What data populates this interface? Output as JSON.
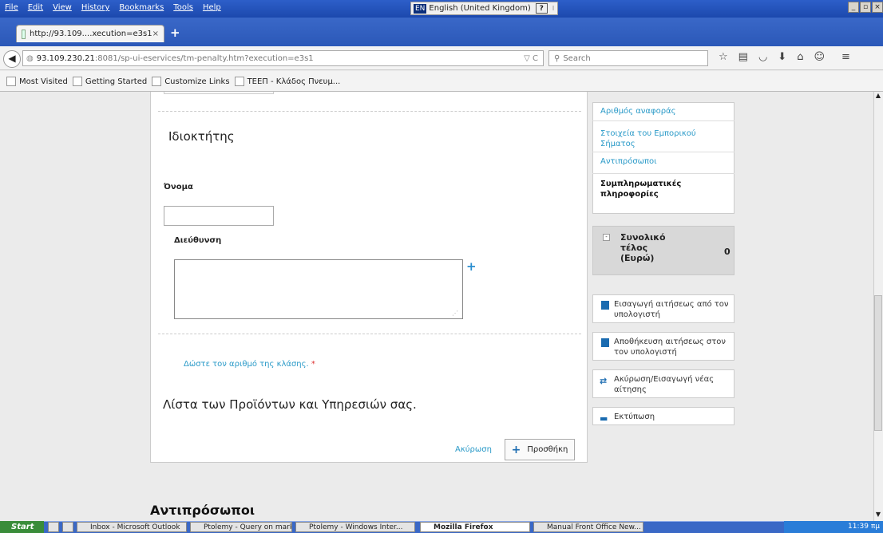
{
  "menubar": {
    "items": [
      "File",
      "Edit",
      "View",
      "History",
      "Bookmarks",
      "Tools",
      "Help"
    ]
  },
  "language": {
    "code": "EN",
    "label": "English (United Kingdom)",
    "help": "?"
  },
  "tab": {
    "title": "http://93.109....xecution=e3s1",
    "close": "×",
    "new": "+"
  },
  "urlbar": {
    "host": "93.109.230.21",
    "rest": ":8081/sp-ui-eservices/tm-penalty.htm?execution=e3s1",
    "reload": "▽ C"
  },
  "search": {
    "placeholder": "Search"
  },
  "bookmarks": [
    "Most Visited",
    "Getting Started",
    "Customize Links",
    "ΤΕΕΠ - Κλάδος Πνευμ..."
  ],
  "form": {
    "owner_heading": "Ιδιοκτήτης",
    "name_label": "Όνομα",
    "name_value": "",
    "address_label": "Διεύθυνση",
    "address_value": "",
    "add_address": "+",
    "class_link": "Δώστε τον αριθμό της κλάσης.",
    "required_mark": "*",
    "products_heading": "Λίστα των Προϊόντων και Υπηρεσιών σας.",
    "cancel": "Ακύρωση",
    "add_button": "Προσθήκη",
    "representatives_heading": "Αντιπρόσωποι"
  },
  "sidenav": {
    "items": [
      "Αριθμός αναφοράς",
      "Στοιχεία του Εμπορικού Σήματος",
      "Αντιπρόσωποι"
    ],
    "active": "Συμπληρωματικές πληροφορίες"
  },
  "total": {
    "label": "Συνολικό τέλος (Ευρώ)",
    "value": "0"
  },
  "actions": {
    "import": "Εισαγωγή αιτήσεως από τον υπολογιστή",
    "save": "Αποθήκευση αιτήσεως στον τον υπολογιστή",
    "cancel_new": "Ακύρωση/Εισαγωγή νέας αίτησης",
    "print": "Εκτύπωση"
  },
  "taskbar": {
    "start": "Start",
    "items": [
      "Inbox - Microsoft Outlook",
      "Ptolemy - Query on mark...",
      "Ptolemy - Windows Inter...",
      "Mozilla Firefox",
      "Manual Front Office New..."
    ],
    "clock": "11:39 πμ"
  }
}
